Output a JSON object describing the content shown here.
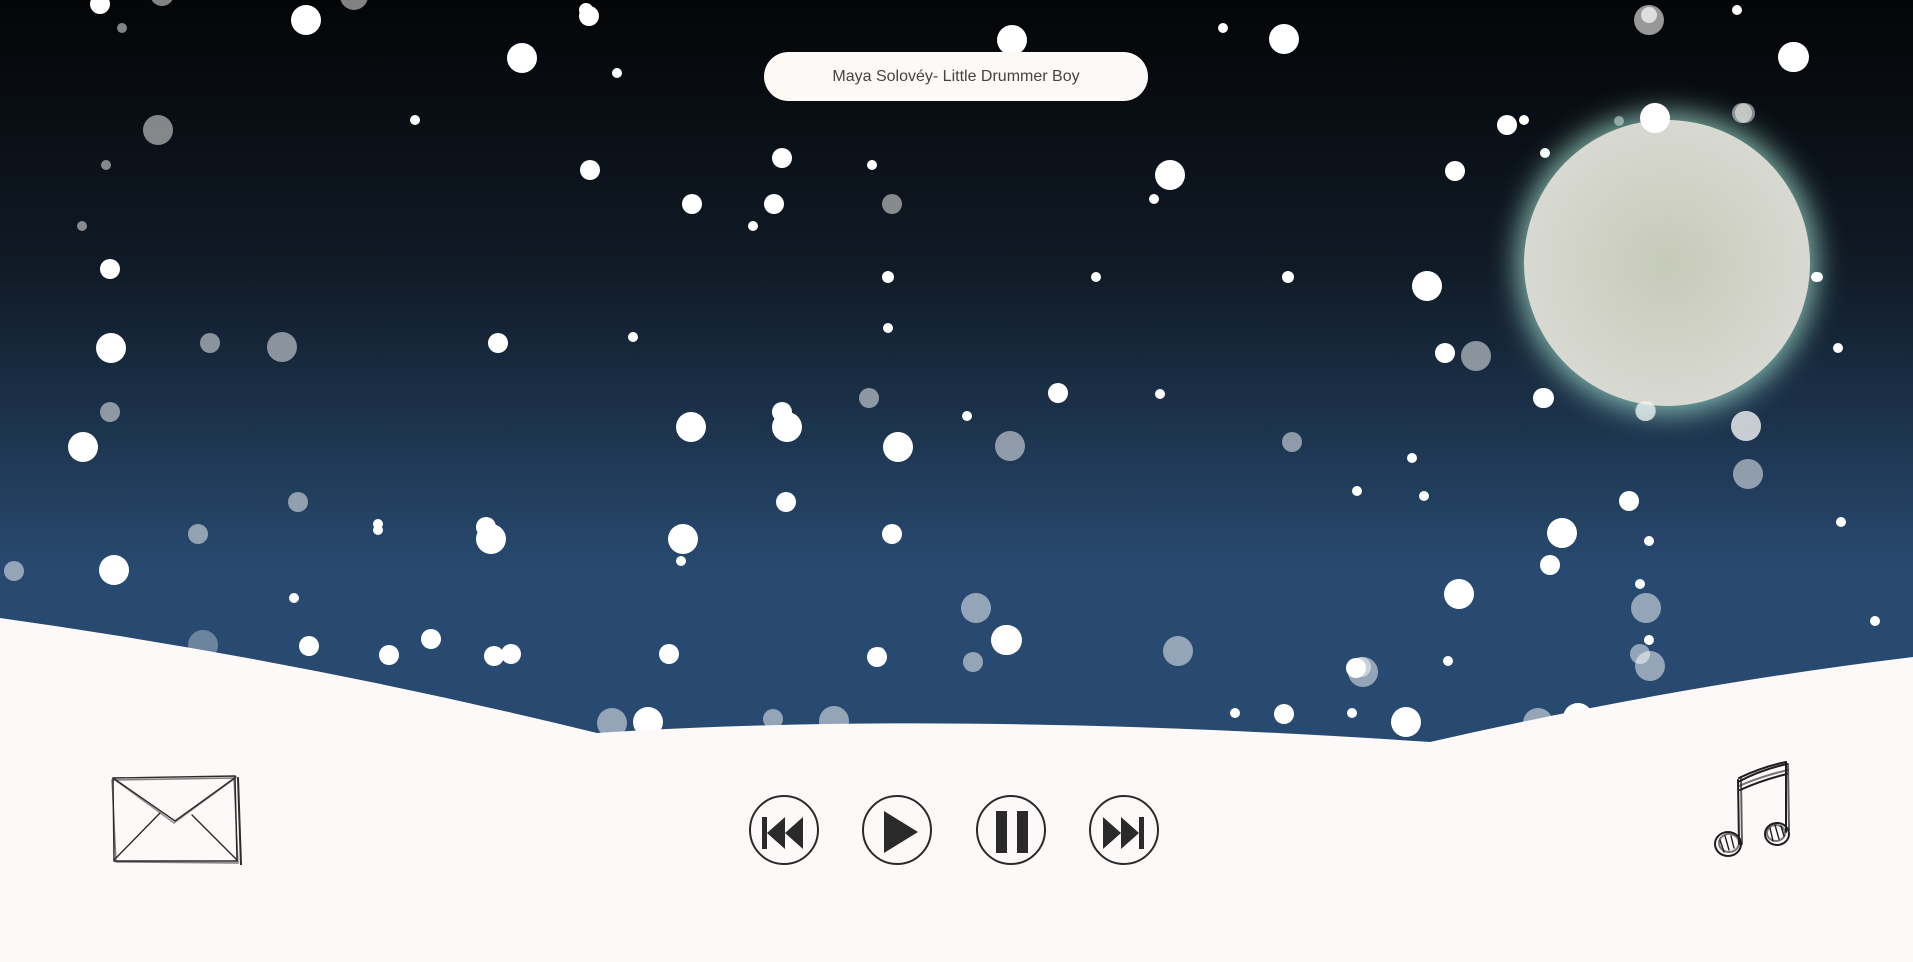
{
  "player": {
    "now_playing": "Maya Solovéy- Little Drummer Boy",
    "controls": [
      {
        "name": "previous-button",
        "icon": "skip-back-icon"
      },
      {
        "name": "play-button",
        "icon": "play-icon"
      },
      {
        "name": "pause-button",
        "icon": "pause-icon"
      },
      {
        "name": "next-button",
        "icon": "skip-forward-icon"
      }
    ]
  },
  "shortcuts": {
    "mail_icon": "envelope-icon",
    "music_icon": "music-note-icon"
  },
  "colors": {
    "sky_top": "#040506",
    "sky_bottom": "#284a70",
    "snow": "#fcf9f8",
    "moon": "#cdd0c4",
    "moon_glow": "#a8e8d6",
    "icon_stroke": "#2a2a2a"
  }
}
